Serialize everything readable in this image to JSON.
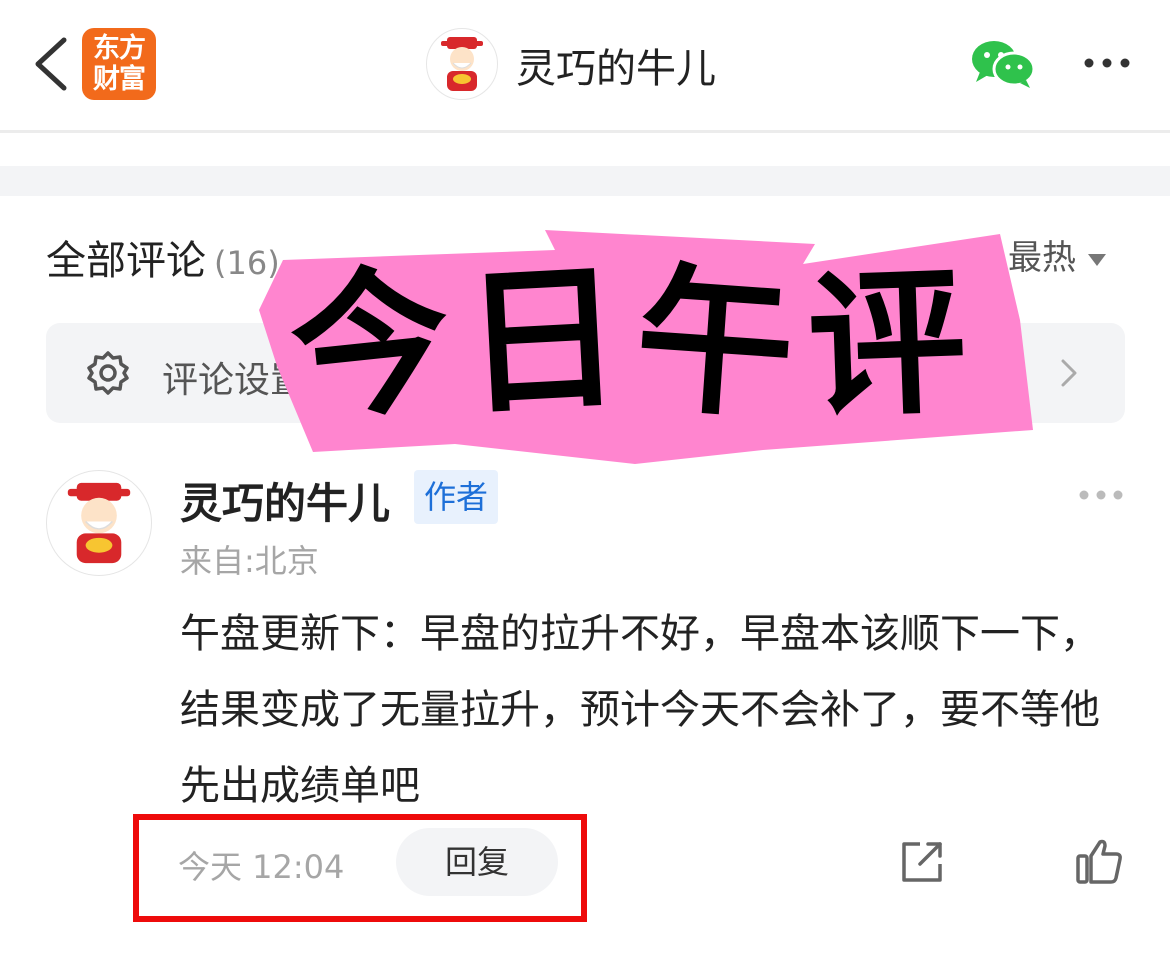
{
  "topbar": {
    "back_icon": "chevron-left-icon",
    "logo_line1": "东方",
    "logo_line2": "财富",
    "logo_color": "#f26a1b",
    "title": "灵巧的牛儿",
    "share_icon": "wechat-icon",
    "more_icon": "more-horizontal-icon"
  },
  "comments": {
    "title": "全部评论",
    "count": "(16)",
    "sort_label": "最热",
    "settings_label": "评论设置"
  },
  "sticker": {
    "text": [
      "今",
      "日",
      "午",
      "评"
    ],
    "color": "#ff85cf"
  },
  "comment": {
    "author": "灵巧的牛儿",
    "badge": "作者",
    "location": "来自:北京",
    "body": "午盘更新下：早盘的拉升不好，早盘本该顺下一下，结果变成了无量拉升，预计今天不会补了，要不等他先出成绩单吧",
    "time": "今天 12:04",
    "reply_label": "回复",
    "highlight_color": "#ee0b0b"
  }
}
